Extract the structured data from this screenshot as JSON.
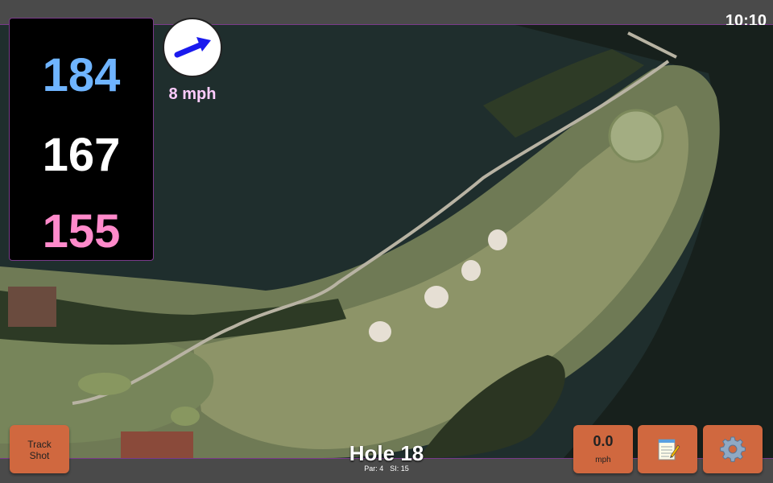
{
  "status": {
    "time": "10:10"
  },
  "distances": {
    "back": "184",
    "middle": "167",
    "front": "155"
  },
  "wind": {
    "speed_label": "8 mph",
    "direction_icon": "arrow-icon"
  },
  "hole": {
    "title": "Hole 18",
    "par_label": "Par: 4",
    "si_label": "SI: 15"
  },
  "controls": {
    "track_shot_line1": "Track",
    "track_shot_line2": "Shot",
    "windspeed_value": "0.0",
    "windspeed_unit": "mph",
    "notes_icon": "notepad-icon",
    "settings_icon": "gear-icon"
  },
  "colors": {
    "back_distance": "#6fb4ff",
    "middle_distance": "#ffffff",
    "front_distance": "#ff8acb",
    "button": "#d0683f",
    "wind_arrow": "#1a1aee"
  }
}
